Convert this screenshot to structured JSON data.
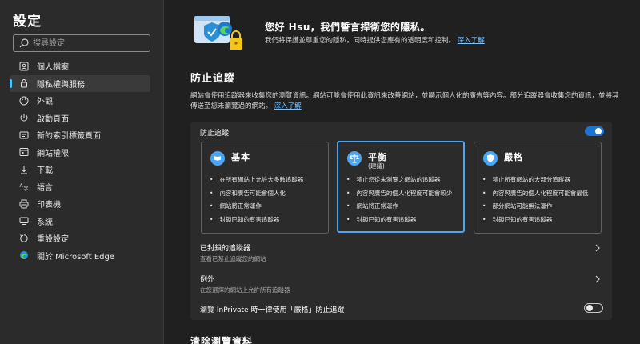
{
  "sidebar": {
    "title": "設定",
    "search_placeholder": "搜尋設定",
    "items": [
      {
        "label": "個人檔案",
        "icon": "profile-icon"
      },
      {
        "label": "隱私權與服務",
        "icon": "lock-icon",
        "active": true
      },
      {
        "label": "外觀",
        "icon": "palette-icon"
      },
      {
        "label": "啟動頁面",
        "icon": "power-icon"
      },
      {
        "label": "新的索引標籤頁面",
        "icon": "new-tab-icon"
      },
      {
        "label": "網站權限",
        "icon": "site-permissions-icon"
      },
      {
        "label": "下載",
        "icon": "download-icon"
      },
      {
        "label": "語言",
        "icon": "language-icon"
      },
      {
        "label": "印表機",
        "icon": "printer-icon"
      },
      {
        "label": "系統",
        "icon": "system-icon"
      },
      {
        "label": "重設設定",
        "icon": "reset-icon"
      },
      {
        "label": "關於 Microsoft Edge",
        "icon": "edge-icon"
      }
    ]
  },
  "header": {
    "greeting": "您好 Hsu，我們誓言捍衛您的隱私。",
    "subtitle": "我們將保護並尊重您的隱私，同時提供您應有的透明度和控制。",
    "learn_more": "深入了解"
  },
  "tracking": {
    "title": "防止追蹤",
    "description": "網站會使用追蹤器來收集您的瀏覽資訊。網站可能會使用此資訊來改善網站，並顯示個人化的廣告等內容。部分追蹤器會收集您的資訊，並將其傳送至您未瀏覽過的網站。",
    "learn_more": "深入了解",
    "toggle_label": "防止追蹤",
    "toggle_on": true,
    "cards": [
      {
        "title": "基本",
        "subtitle": "",
        "selected": false,
        "icon": "basic-icon",
        "bullets": [
          "在所有網站上允許大多數追蹤器",
          "內容和廣告可能會個人化",
          "網站將正常運作",
          "封鎖已知的有害追蹤器"
        ]
      },
      {
        "title": "平衡",
        "subtitle": "(建議)",
        "selected": true,
        "icon": "balance-scale-icon",
        "bullets": [
          "禁止您從未瀏覽之網站的追蹤器",
          "內容與廣告的個人化程度可能會較少",
          "網站將正常運作",
          "封鎖已知的有害追蹤器"
        ]
      },
      {
        "title": "嚴格",
        "subtitle": "",
        "selected": false,
        "icon": "shield-icon",
        "bullets": [
          "禁止所有網站的大部分追蹤器",
          "內容與廣告的個人化程度可能會最低",
          "部分網站可能無法運作",
          "封鎖已知的有害追蹤器"
        ]
      }
    ],
    "blocked": {
      "title": "已封鎖的追蹤器",
      "subtitle": "查看已禁止追蹤您的網站"
    },
    "exceptions": {
      "title": "例外",
      "subtitle": "在您選擇的網站上允許所有追蹤器"
    },
    "inprivate": {
      "label": "瀏覽 InPrivate 時一律使用「嚴格」防止追蹤",
      "on": false
    }
  },
  "next_section": {
    "title": "清除瀏覽資料"
  },
  "colors": {
    "accent": "#4aa6f5",
    "toggle_on": "#1e73d0",
    "link": "#79c0ff"
  }
}
